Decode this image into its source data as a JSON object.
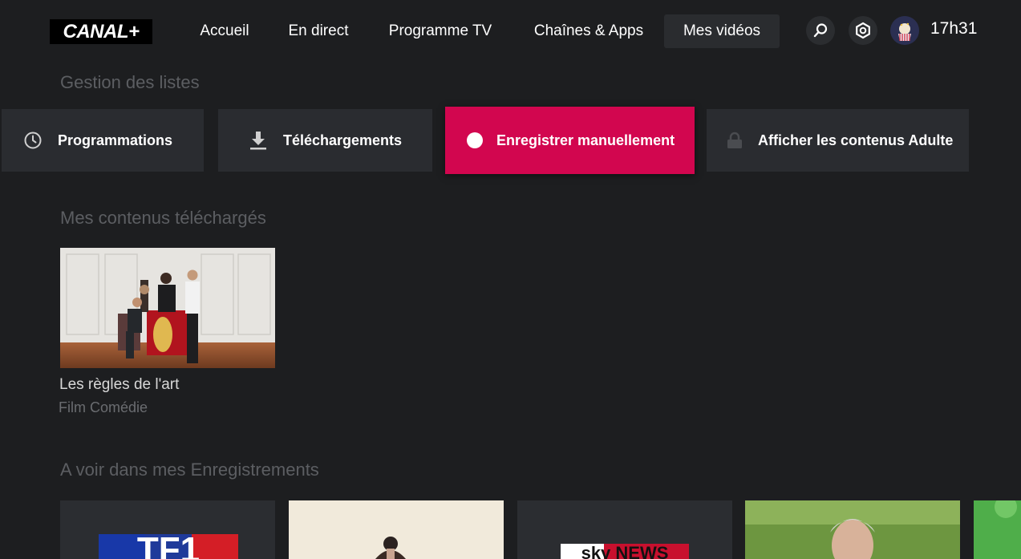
{
  "header": {
    "logo": "CANAL+",
    "nav": [
      "Accueil",
      "En direct",
      "Programme TV",
      "Chaînes & Apps",
      "Mes vidéos"
    ],
    "active_nav": "Mes vidéos",
    "time": "17h31"
  },
  "lists": {
    "title": "Gestion des listes",
    "buttons": [
      {
        "label": "Programmations",
        "icon": "clock-icon"
      },
      {
        "label": "Téléchargements",
        "icon": "download-icon"
      },
      {
        "label": "Enregistrer manuellement",
        "icon": "record-dot-icon",
        "active": true
      },
      {
        "label": "Afficher les contenus Adulte",
        "icon": "lock-icon"
      }
    ]
  },
  "downloaded": {
    "title": "Mes contenus téléchargés",
    "items": [
      {
        "title": "Les règles de l'art",
        "subtitle": "Film Comédie"
      }
    ]
  },
  "recordings": {
    "title": "A voir dans mes Enregistrements",
    "items": [
      {
        "logo": "TF1"
      },
      {
        "logo": ""
      },
      {
        "logo": "sky NEWS"
      },
      {
        "logo": ""
      },
      {
        "logo": ""
      }
    ]
  },
  "colors": {
    "accent": "#d2064f",
    "background": "#1d1e20",
    "button": "#2a2c30"
  }
}
